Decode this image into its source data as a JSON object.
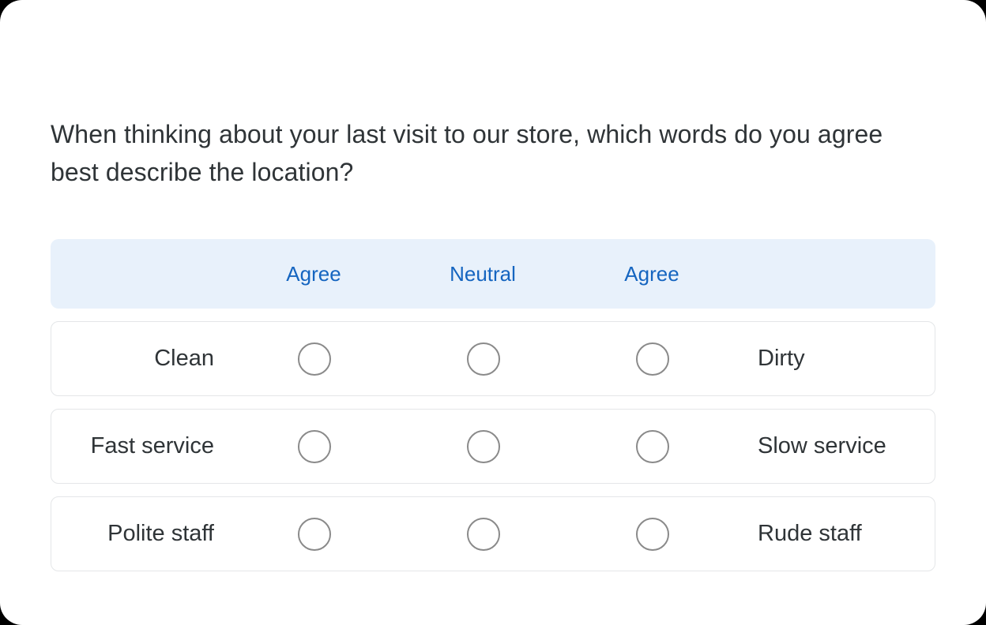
{
  "survey": {
    "question": "When thinking about your last visit to our store, which words do you agree best describe the location?",
    "scale_headers": [
      {
        "label": "Agree"
      },
      {
        "label": "Neutral"
      },
      {
        "label": "Agree"
      }
    ],
    "rows": [
      {
        "left_label": "Clean",
        "right_label": "Dirty",
        "options": [
          {
            "name": "radio-clean-agree",
            "selected": false
          },
          {
            "name": "radio-clean-neutral",
            "selected": false
          },
          {
            "name": "radio-clean-disagree",
            "selected": false
          }
        ]
      },
      {
        "left_label": "Fast service",
        "right_label": "Slow service",
        "options": [
          {
            "name": "radio-fast-service-agree",
            "selected": false
          },
          {
            "name": "radio-fast-service-neutral",
            "selected": false
          },
          {
            "name": "radio-fast-service-disagree",
            "selected": false
          }
        ]
      },
      {
        "left_label": "Polite staff",
        "right_label": "Rude staff",
        "options": [
          {
            "name": "radio-polite-staff-agree",
            "selected": false
          },
          {
            "name": "radio-polite-staff-neutral",
            "selected": false
          },
          {
            "name": "radio-polite-staff-disagree",
            "selected": false
          }
        ]
      }
    ]
  },
  "colors": {
    "page_background": "#ffffff",
    "outside_background": "#000000",
    "header_band": "#e8f1fb",
    "header_text": "#1565c0",
    "body_text": "#2f3437",
    "row_border": "#e4e6e8",
    "radio_border": "#8a8a8a"
  }
}
